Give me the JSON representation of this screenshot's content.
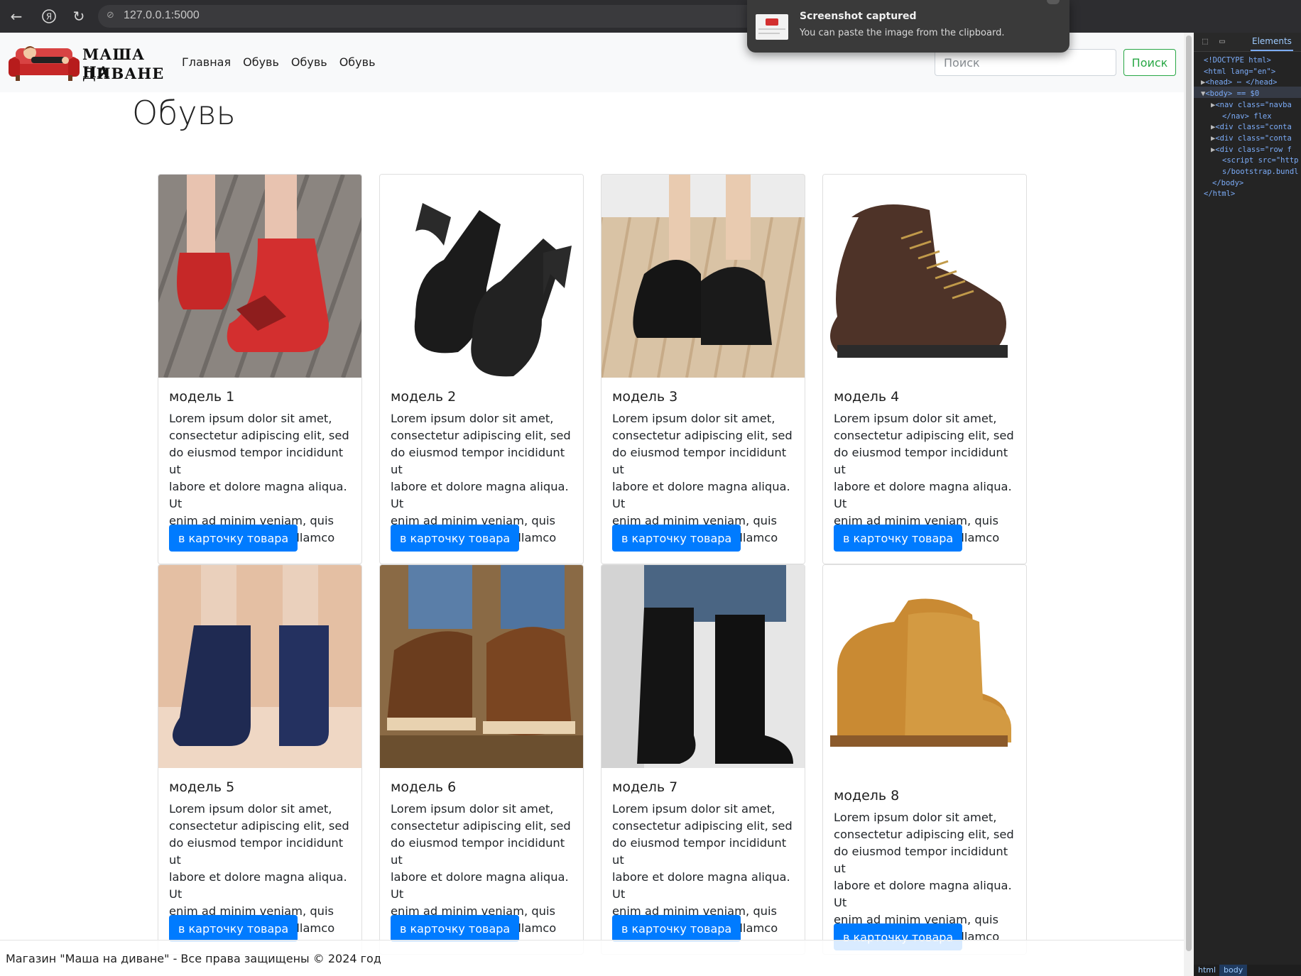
{
  "browser": {
    "url": "127.0.0.1:5000"
  },
  "toast": {
    "title": "Screenshot captured",
    "text": "You can paste the image from the clipboard."
  },
  "navbar": {
    "brand_line1": "МАША НА",
    "brand_line2": "ДИВАНЕ",
    "links": [
      "Главная",
      "Обувь",
      "Обувь",
      "Обувь"
    ],
    "search_placeholder": "Поиск",
    "search_button": "Поиск"
  },
  "page": {
    "heading": "Обувь"
  },
  "products": [
    {
      "title": "модель 1",
      "button": "в карточку товара",
      "image_icon": "red-ankle-boots-photo"
    },
    {
      "title": "модель 2",
      "button": "в карточку товара",
      "image_icon": "black-boots-with-wings-photo"
    },
    {
      "title": "модель 3",
      "button": "в карточку товара",
      "image_icon": "black-platform-shoes-photo"
    },
    {
      "title": "модель 4",
      "button": "в карточку товара",
      "image_icon": "brown-hiking-boot-photo"
    },
    {
      "title": "модель 5",
      "button": "в карточку товара",
      "image_icon": "navy-winter-boots-photo"
    },
    {
      "title": "модель 6",
      "button": "в карточку товара",
      "image_icon": "brown-fur-boots-photo"
    },
    {
      "title": "модель 7",
      "button": "в карточку товара",
      "image_icon": "tall-black-lace-up-boots-photo"
    },
    {
      "title": "модель 8",
      "button": "в карточку товара",
      "image_icon": "tan-work-boots-photo"
    }
  ],
  "card_text": "Lorem ipsum dolor sit amet, consectetur adipiscing elit, sed do eiusmod tempor incididunt ut labore et dolore magna aliqua. Ut enim ad minim veniam, quis nostrud exercitation ullamco",
  "card_text_lines": [
    "Lorem ipsum dolor sit amet,",
    "consectetur adipiscing elit, sed",
    "do eiusmod tempor incididunt ut",
    "labore et dolore magna aliqua. Ut",
    "enim ad minim veniam, quis",
    "nostrud exercitation ullamco"
  ],
  "footer": {
    "text": "Магазин \"Маша на диване\" - Все права защищены © 2024 год"
  },
  "devtools": {
    "tab": "Elements",
    "lines": [
      "<!DOCTYPE html>",
      "<html lang=\"en\">",
      "<head> ⋯ </head>",
      "<body> == $0",
      "<nav class=\"navba",
      "</nav> flex",
      "<div class=\"conta",
      "<div class=\"conta",
      "<div class=\"row f",
      "<script src=\"http",
      "s/bootstrap.bundl",
      "</body>",
      "</html>"
    ],
    "breadcrumb": [
      "html",
      "body"
    ]
  },
  "colors": {
    "primary": "#007bff",
    "success": "#28a745",
    "navbar_bg": "#f8f9fa"
  }
}
